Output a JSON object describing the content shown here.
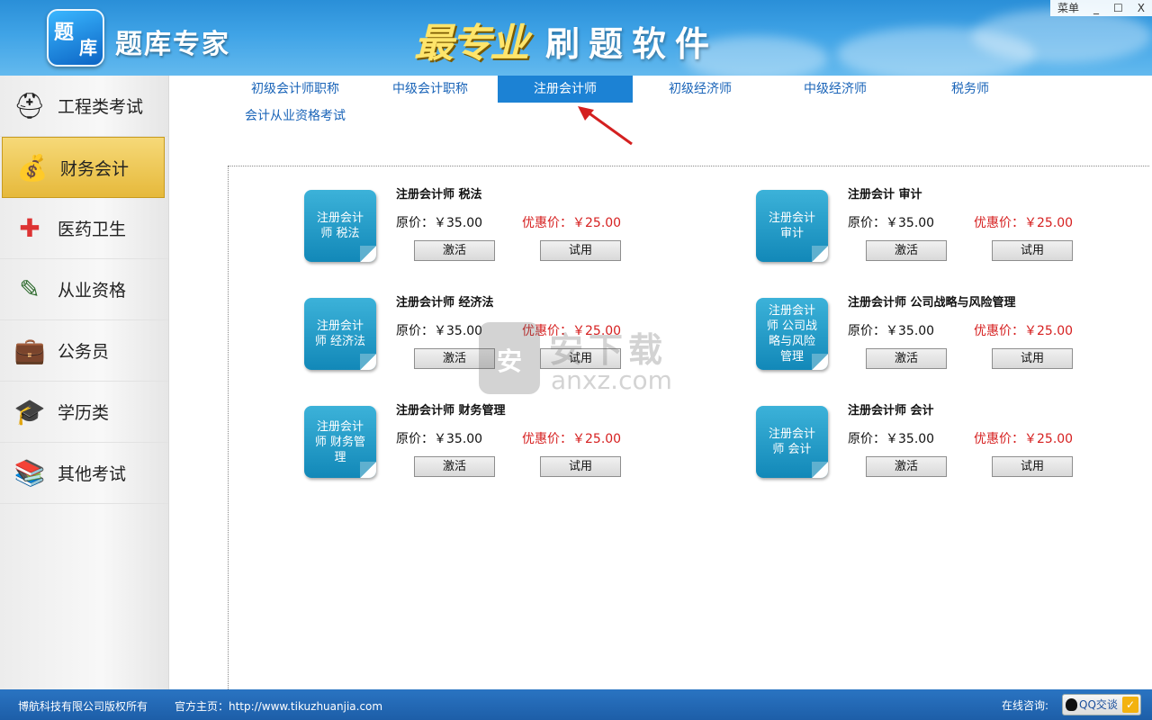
{
  "header": {
    "logo_line1": "题",
    "logo_line2": "库",
    "app_title": "题库专家",
    "brand_logo": "最专业",
    "slogan": "刷题软件",
    "window_controls": {
      "menu": "菜单",
      "minimize": "_",
      "maximize": "☐",
      "close": "X"
    }
  },
  "sidebar": {
    "items": [
      {
        "label": "工程类考试",
        "icon": "hardhat-icon",
        "glyph": "⛑"
      },
      {
        "label": "财务会计",
        "icon": "money-bag-icon",
        "glyph": "💰",
        "active": true
      },
      {
        "label": "医药卫生",
        "icon": "medical-kit-icon",
        "glyph": "✚"
      },
      {
        "label": "从业资格",
        "icon": "chalkboard-icon",
        "glyph": "✎"
      },
      {
        "label": "公务员",
        "icon": "briefcase-icon",
        "glyph": "💼"
      },
      {
        "label": "学历类",
        "icon": "graduation-cap-icon",
        "glyph": "🎓"
      },
      {
        "label": "其他考试",
        "icon": "books-icon",
        "glyph": "📚"
      }
    ]
  },
  "tabs": [
    {
      "label": "初级会计师职称"
    },
    {
      "label": "中级会计职称"
    },
    {
      "label": "注册会计师",
      "active": true
    },
    {
      "label": "初级经济师"
    },
    {
      "label": "中级经济师"
    },
    {
      "label": "税务师"
    },
    {
      "label": "会计从业资格考试"
    }
  ],
  "products": [
    {
      "icon_text": "注册会计师 税法",
      "title": "注册会计师 税法",
      "price": "原价：￥35.00",
      "discount": "优惠价：￥25.00",
      "activate": "激活",
      "trial": "试用"
    },
    {
      "icon_text": "注册会计 审计",
      "title": "注册会计 审计",
      "price": "原价：￥35.00",
      "discount": "优惠价：￥25.00",
      "activate": "激活",
      "trial": "试用"
    },
    {
      "icon_text": "注册会计师 经济法",
      "title": "注册会计师 经济法",
      "price": "原价：￥35.00",
      "discount": "优惠价：￥25.00",
      "activate": "激活",
      "trial": "试用"
    },
    {
      "icon_text": "注册会计师 公司战略与风险管理",
      "title": "注册会计师 公司战略与风险管理",
      "price": "原价：￥35.00",
      "discount": "优惠价：￥25.00",
      "activate": "激活",
      "trial": "试用"
    },
    {
      "icon_text": "注册会计师 财务管理",
      "title": "注册会计师 财务管理",
      "price": "原价：￥35.00",
      "discount": "优惠价：￥25.00",
      "activate": "激活",
      "trial": "试用"
    },
    {
      "icon_text": "注册会计师 会计",
      "title": "注册会计师 会计",
      "price": "原价：￥35.00",
      "discount": "优惠价：￥25.00",
      "activate": "激活",
      "trial": "试用"
    }
  ],
  "watermark": {
    "text": "安下载",
    "domain": "anxz.com",
    "shield_char": "安"
  },
  "footer": {
    "copyright": "博航科技有限公司版权所有",
    "homepage": "官方主页：http://www.tikuzhuanjia.com",
    "online_consult": "在线咨询:",
    "qq_button": "QQ交谈",
    "check": "✓"
  },
  "colors": {
    "header_blue": "#3fa3e6",
    "active_tab": "#1c82d4",
    "discount_red": "#d62020",
    "active_side": "#e6b93b"
  }
}
